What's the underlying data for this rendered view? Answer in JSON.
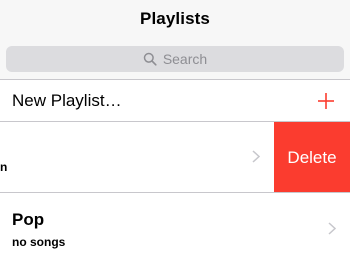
{
  "nav": {
    "title": "Playlists"
  },
  "search": {
    "placeholder": "Search",
    "icon": "search-icon"
  },
  "rows": {
    "new_playlist": {
      "label": "New Playlist…",
      "icon": "plus-icon",
      "icon_color": "#fb3c2f"
    },
    "swiped": {
      "subtitle_fragment": "n",
      "delete_label": "Delete",
      "delete_color": "#fb3c2f"
    },
    "pop": {
      "title": "Pop",
      "subtitle": "no songs"
    }
  }
}
